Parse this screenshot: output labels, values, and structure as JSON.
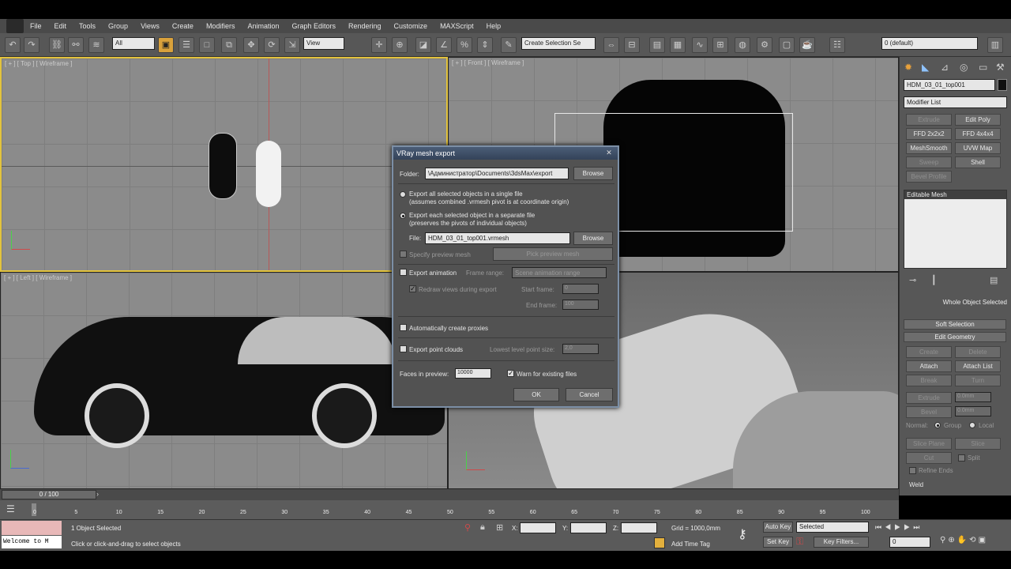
{
  "menubar": {
    "items": [
      "File",
      "Edit",
      "Tools",
      "Group",
      "Views",
      "Create",
      "Modifiers",
      "Animation",
      "Graph Editors",
      "Rendering",
      "Customize",
      "MAXScript",
      "Help"
    ]
  },
  "toolbar": {
    "selection_filter": "All",
    "reference_coord": "View",
    "selection_set": "Create Selection Se",
    "layer": "0 (default)"
  },
  "viewports": {
    "top": "[ + ] [ Top ] [ Wireframe ]",
    "front": "[ + ] [ Front ] [ Wireframe ]",
    "left": "[ + ] [ Left ] [ Wireframe ]"
  },
  "command_panel": {
    "object_name": "HDM_03_01_top001",
    "modifier_list": "Modifier List",
    "buttons": [
      "Extrude",
      "Edit Poly",
      "FFD 2x2x2",
      "FFD 4x4x4",
      "MeshSmooth",
      "UVW Map",
      "Sweep",
      "Shell"
    ],
    "bevel_profile": "Bevel Profile",
    "stack_item": "Editable Mesh",
    "whole_object": "Whole Object Selected",
    "soft_selection": "Soft Selection",
    "edit_geometry": "Edit Geometry",
    "geo_buttons": [
      "Create",
      "Delete",
      "Attach",
      "Attach List",
      "Break",
      "Turn",
      "Extrude",
      "Bevel"
    ],
    "geo_values": [
      "0.0mm",
      "0.0mm"
    ],
    "normal_label": "Normal:",
    "group_label": "Group",
    "local_label": "Local",
    "slice_plane": "Slice Plane",
    "slice": "Slice",
    "cut": "Cut",
    "split": "Split",
    "refine_ends": "Refine Ends",
    "weld": "Weld",
    "selected": "Selected",
    "weld_value": "0.1mm",
    "targeted": "Targeted"
  },
  "dialog": {
    "title": "VRay mesh export",
    "folder_label": "Folder:",
    "folder_value": "\\Администратор\\Documents\\3dsMax\\export",
    "browse": "Browse",
    "option_single": "Export all selected objects in a single file",
    "option_single_note": "(assumes combined .vrmesh pivot is at coordinate origin)",
    "option_separate": "Export each selected object in a separate file",
    "option_separate_note": "(preserves the pivots of individual objects)",
    "file_label": "File:",
    "file_value": "HDM_03_01_top001.vrmesh",
    "specify_preview": "Specify preview mesh",
    "pick_preview": "Pick preview mesh",
    "export_animation": "Export animation",
    "frame_range_label": "Frame range:",
    "frame_range_value": "Scene animation range",
    "redraw_views": "Redraw views during export",
    "start_frame_label": "Start frame:",
    "start_frame_value": "0",
    "end_frame_label": "End frame:",
    "end_frame_value": "100",
    "auto_proxies": "Automatically create proxies",
    "export_point_clouds": "Export point clouds",
    "lowest_level_label": "Lowest level point size:",
    "lowest_level_value": "2,0",
    "faces_label": "Faces in preview:",
    "faces_value": "10000",
    "warn_existing": "Warn for existing files",
    "ok": "OK",
    "cancel": "Cancel"
  },
  "timeline": {
    "frame": "0 / 100",
    "ticks": [
      "0",
      "5",
      "10",
      "15",
      "20",
      "25",
      "30",
      "35",
      "40",
      "45",
      "50",
      "55",
      "60",
      "65",
      "70",
      "75",
      "80",
      "85",
      "90",
      "95",
      "100"
    ]
  },
  "status": {
    "welcome": "Welcome to M",
    "selected": "1 Object Selected",
    "prompt": "Click or click-and-drag to select objects",
    "x_label": "X:",
    "y_label": "Y:",
    "z_label": "Z:",
    "grid": "Grid = 1000,0mm",
    "add_time_tag": "Add Time Tag",
    "auto_key": "Auto Key",
    "set_key": "Set Key",
    "key_mode": "Selected",
    "key_filters": "Key Filters...",
    "current_frame": "0"
  }
}
